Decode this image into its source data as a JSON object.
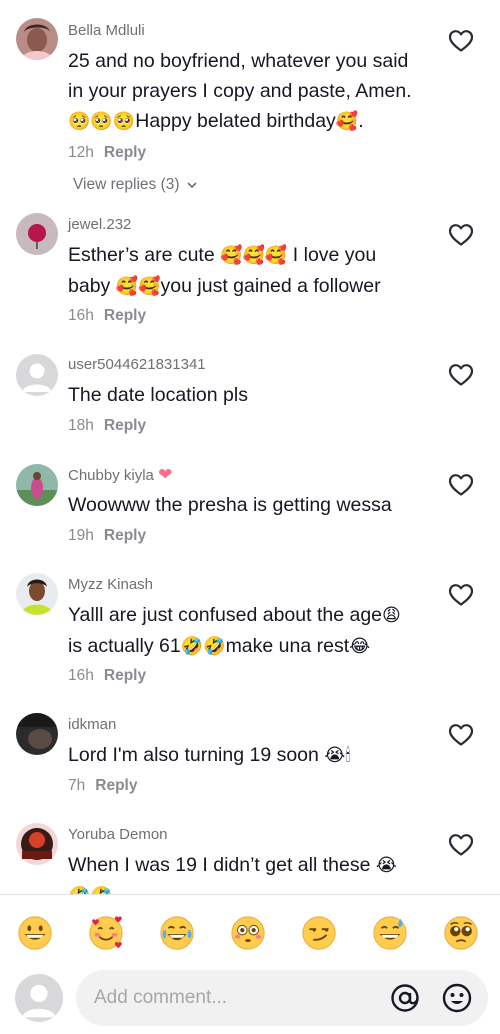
{
  "comments": [
    {
      "username": "Bella Mdluli",
      "text_line1": "25 and no boyfriend, whatever you said",
      "text_line2": "in your prayers I copy and paste, Amen.",
      "text_line3_emoji": "🥺🥺🥺",
      "text_line3": "Happy belated birthday",
      "text_line3_emoji2": "🥰",
      "text_line3_end": ".",
      "time": "12h",
      "reply": "Reply",
      "view_replies": "View replies (3)"
    },
    {
      "username": "jewel.232",
      "text_line1": "Esther’s are cute ",
      "text_line1_emoji": "🥰🥰🥰",
      "text_line1_end": " I love you",
      "text_line2": "baby ",
      "text_line2_emoji": "🥰🥰",
      "text_line2_end": "you just gained a follower",
      "time": "16h",
      "reply": "Reply"
    },
    {
      "username": "user5044621831341",
      "text_line1": "The date location pls",
      "time": "18h",
      "reply": "Reply"
    },
    {
      "username": "Chubby kiyla",
      "username_emoji": "❤",
      "text_line1": "Woowww the presha is getting wessa",
      "time": "19h",
      "reply": "Reply"
    },
    {
      "username": "Myzz Kinash",
      "text_line1": "Yalll are just confused about the age",
      "text_line1_emoji": "😩",
      "text_line2": "is actually 61",
      "text_line2_emoji": "🤣🤣",
      "text_line2_end": "make una rest",
      "text_line2_emoji2": "😂",
      "time": "16h",
      "reply": "Reply"
    },
    {
      "username": "idkman",
      "text_line1": "Lord I'm also turning 19 soon ",
      "text_line1_emoji": "😭🕯",
      "time": "7h",
      "reply": "Reply"
    },
    {
      "username": "Yoruba Demon",
      "text_line1": "When I was 19 I didn’t get all these ",
      "text_line1_emoji": "😭",
      "text_line2_emoji": "🤣🤣"
    }
  ],
  "emoji_bar": [
    "grinning-face",
    "smiling-face-with-hearts",
    "face-with-tears-of-joy",
    "flushed-face",
    "smirking-face",
    "grinning-face-with-sweat",
    "pleading-face"
  ],
  "composer": {
    "placeholder": "Add comment...",
    "at_icon": "at-icon",
    "emoji_icon": "smiley-icon"
  },
  "colors": {
    "text": "#161823",
    "secondary": "#8a8b91",
    "input_bg": "#f1f1f2",
    "heart_pink": "#fe6b8b"
  }
}
